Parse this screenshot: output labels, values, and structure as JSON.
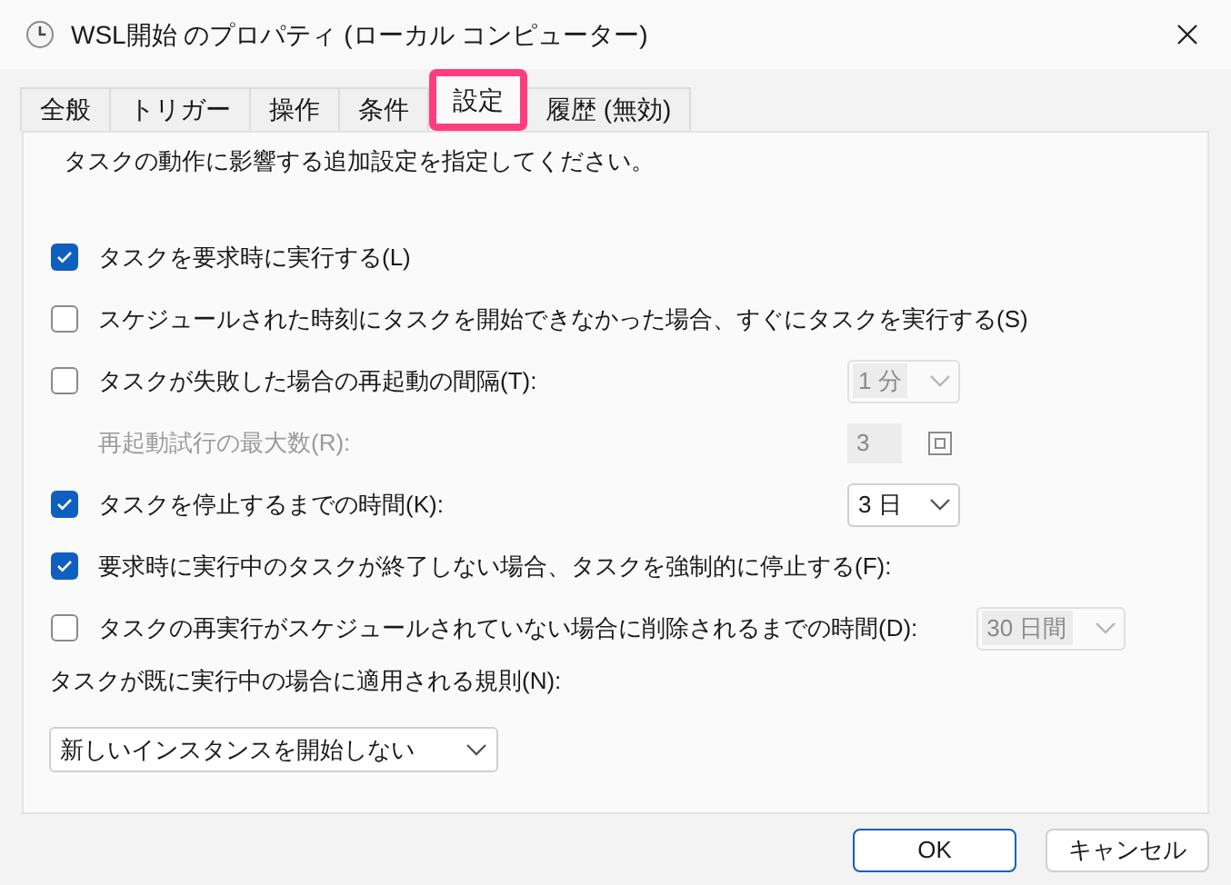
{
  "window": {
    "title": "WSL開始 のプロパティ (ローカル コンピューター)"
  },
  "tabs": [
    {
      "label": "全般",
      "selected": false
    },
    {
      "label": "トリガー",
      "selected": false
    },
    {
      "label": "操作",
      "selected": false
    },
    {
      "label": "条件",
      "selected": false
    },
    {
      "label": "設定",
      "selected": true
    },
    {
      "label": "履歴 (無効)",
      "selected": false
    }
  ],
  "intro": "タスクの動作に影響する追加設定を指定してください。",
  "options": [
    {
      "kind": "checkbox",
      "label": "タスクを要求時に実行する(L)",
      "checked": true
    },
    {
      "kind": "checkbox",
      "label": "スケジュールされた時刻にタスクを開始できなかった場合、すぐにタスクを実行する(S)",
      "checked": false
    },
    {
      "kind": "checkbox",
      "label": "タスクが失敗した場合の再起動の間隔(T):",
      "checked": false,
      "control": {
        "kind": "dropdown",
        "value": "1 分",
        "disabled": true
      }
    },
    {
      "kind": "subsetting",
      "label": "再起動試行の最大数(R):",
      "disabled": true,
      "control": {
        "kind": "spin",
        "value": "3",
        "disabled": true
      }
    },
    {
      "kind": "checkbox",
      "label": "タスクを停止するまでの時間(K):",
      "checked": true,
      "control": {
        "kind": "dropdown",
        "value": "3 日",
        "disabled": false
      }
    },
    {
      "kind": "checkbox",
      "label": "要求時に実行中のタスクが終了しない場合、タスクを強制的に停止する(F):",
      "checked": true
    },
    {
      "kind": "checkbox",
      "label": "タスクの再実行がスケジュールされていない場合に削除されるまでの時間(D):",
      "checked": false,
      "control": {
        "kind": "dropdown",
        "value": "30 日間",
        "disabled": true
      }
    }
  ],
  "rule": {
    "label": "タスクが既に実行中の場合に適用される規則(N):",
    "value": "新しいインスタンスを開始しない"
  },
  "buttons": [
    "OK",
    "キャンセル"
  ]
}
